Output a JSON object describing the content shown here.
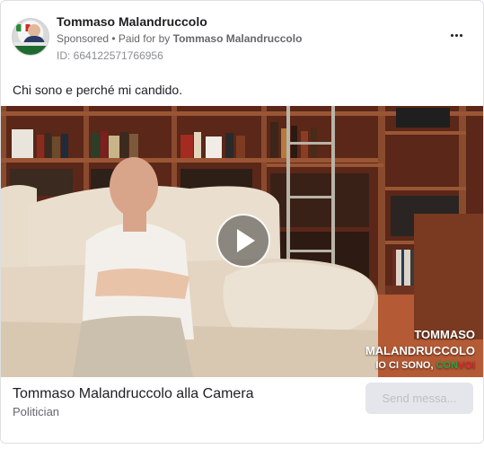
{
  "ad": {
    "page_name": "Tommaso Malandruccolo",
    "sponsored": "Sponsored",
    "paid_for_prefix": " • Paid for by ",
    "paid_for_name": "Tommaso Malandruccolo",
    "ad_id": "ID: 664122571766956",
    "more_icon": "more-options-icon",
    "caption": "Chi sono e perché mi candido."
  },
  "video": {
    "overlay_line1": "TOMMASO",
    "overlay_line2": "MALANDRUCCOLO",
    "overlay_tag_prefix": "IO CI SONO, ",
    "overlay_tag_con": "CON",
    "overlay_tag_voi": "VOI",
    "play_icon": "play-icon"
  },
  "footer": {
    "title": "Tommaso Malandruccolo alla Camera",
    "subtitle": "Politician",
    "button_label": "Send messa..."
  },
  "colors": {
    "overlay_green": "#2ea043",
    "overlay_red": "#e0272f",
    "button_bg": "#e4e6eb"
  }
}
